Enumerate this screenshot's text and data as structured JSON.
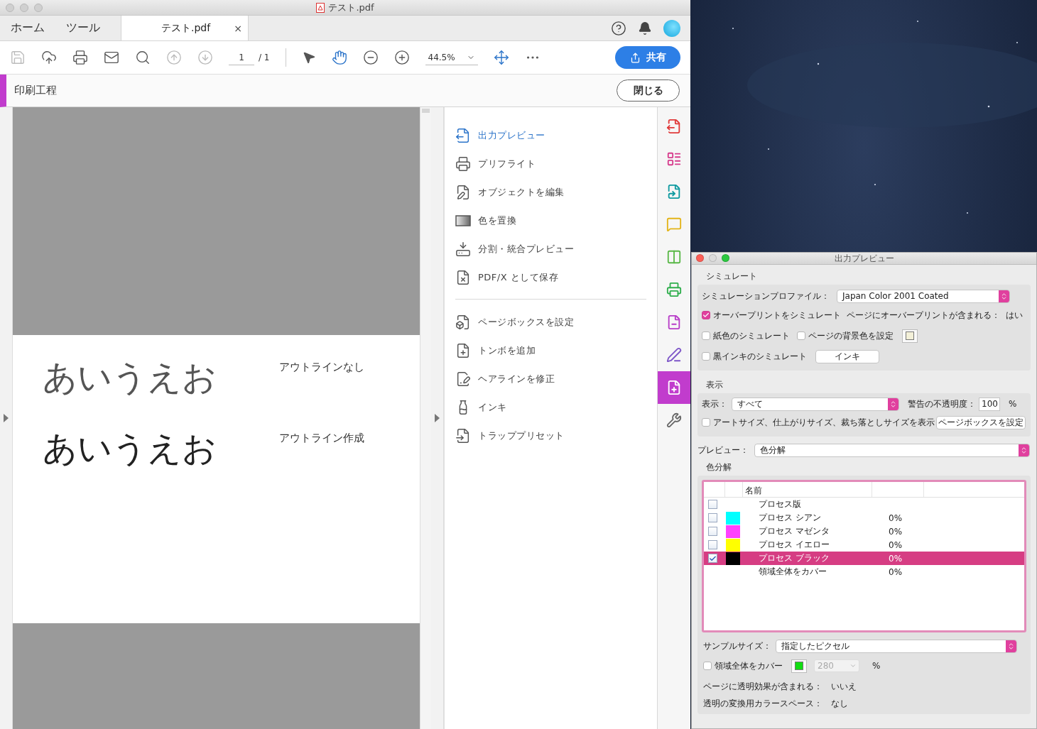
{
  "window": {
    "title": "テスト.pdf"
  },
  "nav_tabs": [
    {
      "label": "ホーム",
      "selected": false
    },
    {
      "label": "ツール",
      "selected": false
    },
    {
      "label": "テスト.pdf",
      "selected": true,
      "close": "×"
    }
  ],
  "toolbar": {
    "page_number": "1",
    "page_total": "/ 1",
    "zoom": "44.5%",
    "share_button": "共有"
  },
  "tool_header": {
    "title": "印刷工程",
    "close_button": "閉じる"
  },
  "page": {
    "lines": [
      {
        "sample": "あいうえお",
        "label": "アウトラインなし",
        "kind": "plain"
      },
      {
        "sample": "あいうえお",
        "label": "アウトライン作成",
        "kind": "outlined"
      }
    ]
  },
  "tools_panel": {
    "groups": [
      [
        {
          "label": "出力プレビュー",
          "selected": true
        },
        {
          "label": "プリフライト",
          "selected": false
        },
        {
          "label": "オブジェクトを編集",
          "selected": false
        },
        {
          "label": "色を置換",
          "selected": false
        },
        {
          "label": "分割・統合プレビュー",
          "selected": false
        },
        {
          "label": "PDF/X として保存",
          "selected": false
        }
      ],
      [
        {
          "label": "ページボックスを設定",
          "selected": false
        },
        {
          "label": "トンボを追加",
          "selected": false
        },
        {
          "label": "ヘアラインを修正",
          "selected": false
        },
        {
          "label": "インキ",
          "selected": false
        },
        {
          "label": "トラッププリセット",
          "selected": false
        }
      ]
    ]
  },
  "right_rail": [
    {
      "selected": false
    },
    {
      "selected": false
    },
    {
      "selected": false
    },
    {
      "selected": false
    },
    {
      "selected": false
    },
    {
      "selected": false
    },
    {
      "selected": false
    },
    {
      "selected": false
    },
    {
      "selected": true
    },
    {
      "selected": false
    }
  ],
  "output_preview": {
    "title": "出力プレビュー",
    "simulate": {
      "heading": "シミュレート",
      "profile_label": "シミュレーションプロファイル：",
      "profile": "Japan Color 2001 Coated",
      "overprint": {
        "label": "オーバープリントをシミュレート",
        "checked": true
      },
      "overprint_info_label": "ページにオーバープリントが含まれる：",
      "overprint_info_value": "はい",
      "paper_color": {
        "label": "紙色のシミュレート",
        "checked": false
      },
      "page_background": {
        "label": "ページの背景色を設定",
        "checked": false
      },
      "black_ink": {
        "label": "黒インキのシミュレート",
        "checked": false
      },
      "ink_button": "インキ"
    },
    "display": {
      "heading": "表示",
      "show_label": "表示：",
      "show_value": "すべて",
      "opacity_label": "警告の不透明度：",
      "opacity_value": "100",
      "opacity_unit": "%",
      "show_boxes": {
        "label": "アートサイズ、仕上がりサイズ、裁ち落としサイズを表示",
        "checked": false
      },
      "page_box_button": "ページボックスを設定"
    },
    "preview_label": "プレビュー：",
    "preview_value": "色分解",
    "separations": {
      "heading": "色分解",
      "columns": [
        "名前"
      ],
      "rows": [
        {
          "kind": "group",
          "name": "プロセス版",
          "checked": false,
          "selected": false
        },
        {
          "kind": "ink",
          "name": "プロセス シアン",
          "color": "#00ffff",
          "coverage": "0%",
          "checked": false,
          "selected": false
        },
        {
          "kind": "ink",
          "name": "プロセス マゼンタ",
          "color": "#ff40ff",
          "coverage": "0%",
          "checked": false,
          "selected": false
        },
        {
          "kind": "ink",
          "name": "プロセス イエロー",
          "color": "#ffff00",
          "coverage": "0%",
          "checked": false,
          "selected": false
        },
        {
          "kind": "ink",
          "name": "プロセス ブラック",
          "color": "#000000",
          "coverage": "0%",
          "checked": true,
          "selected": true
        },
        {
          "kind": "total",
          "name": "領域全体をカバー",
          "coverage": "0%",
          "selected": false
        }
      ]
    },
    "sample_size_label": "サンプルサイズ：",
    "sample_size": "指定したピクセル",
    "total_coverage": {
      "label": "領域全体をカバー",
      "checked": false,
      "value": "280",
      "unit": "%",
      "disabled": true
    },
    "transparency_label": "ページに透明効果が含まれる：",
    "transparency_value": "いいえ",
    "blend_space_label": "透明の変換用カラースペース：",
    "blend_space_value": "なし"
  }
}
